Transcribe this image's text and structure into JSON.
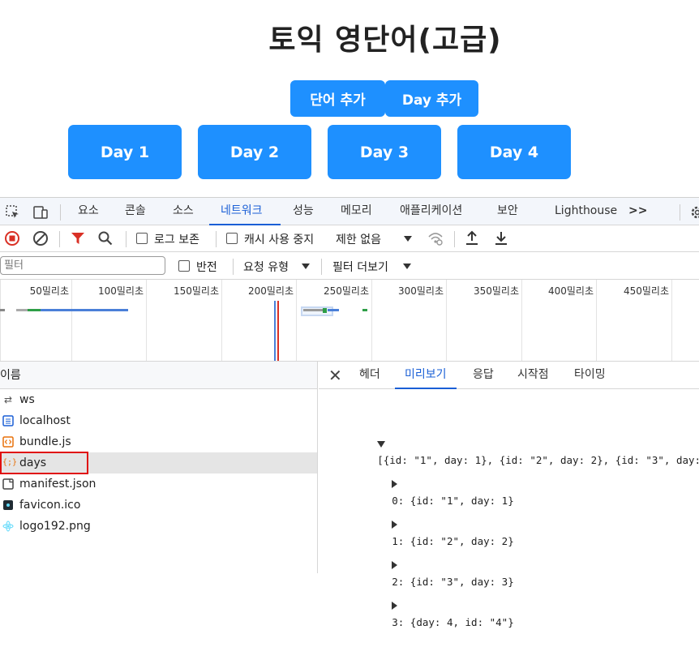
{
  "app": {
    "title": "토익 영단어(고급)",
    "add_word": "단어 추가",
    "add_day": "Day 추가",
    "days": [
      "Day 1",
      "Day 2",
      "Day 3",
      "Day 4"
    ]
  },
  "devtools": {
    "tabs": [
      "요소",
      "콘솔",
      "소스",
      "네트워크",
      "성능",
      "메모리",
      "애플리케이션",
      "보안",
      "Lighthouse"
    ],
    "active_tab": "네트워크",
    "more": ">>",
    "toolbar": {
      "preserve_log": "로그 보존",
      "disable_cache": "캐시 사용 중지",
      "throttle": "제한 없음"
    },
    "filter": {
      "placeholder": "필터",
      "invert": "반전",
      "request_type": "요청 유형",
      "more_filters": "필터 더보기"
    },
    "timeline_ticks": [
      "50밀리초",
      "100밀리초",
      "150밀리초",
      "200밀리초",
      "250밀리초",
      "300밀리초",
      "350밀리초",
      "400밀리초",
      "450밀리초"
    ],
    "name_header": "이름",
    "requests": [
      {
        "name": "ws",
        "icon": "websocket-icon"
      },
      {
        "name": "localhost",
        "icon": "document-icon"
      },
      {
        "name": "bundle.js",
        "icon": "script-icon"
      },
      {
        "name": "days",
        "icon": "json-icon"
      },
      {
        "name": "manifest.json",
        "icon": "manifest-icon"
      },
      {
        "name": "favicon.ico",
        "icon": "favicon-icon"
      },
      {
        "name": "logo192.png",
        "icon": "image-icon"
      }
    ],
    "selected_request": "days",
    "detail_tabs": [
      "헤더",
      "미리보기",
      "응답",
      "시작점",
      "타이밍"
    ],
    "active_detail_tab": "미리보기",
    "preview": {
      "root": "[{id: \"1\", day: 1}, {id: \"2\", day: 2}, {id: \"3\", day:",
      "items": [
        "0: {id: \"1\", day: 1}",
        "1: {id: \"2\", day: 2}",
        "2: {id: \"3\", day: 3}",
        "3: {day: 4, id: \"4\"}"
      ]
    },
    "colors": {
      "accent": "#1a5fd6",
      "record": "#d93025",
      "filter": "#d93025",
      "button": "#1e90ff"
    }
  }
}
